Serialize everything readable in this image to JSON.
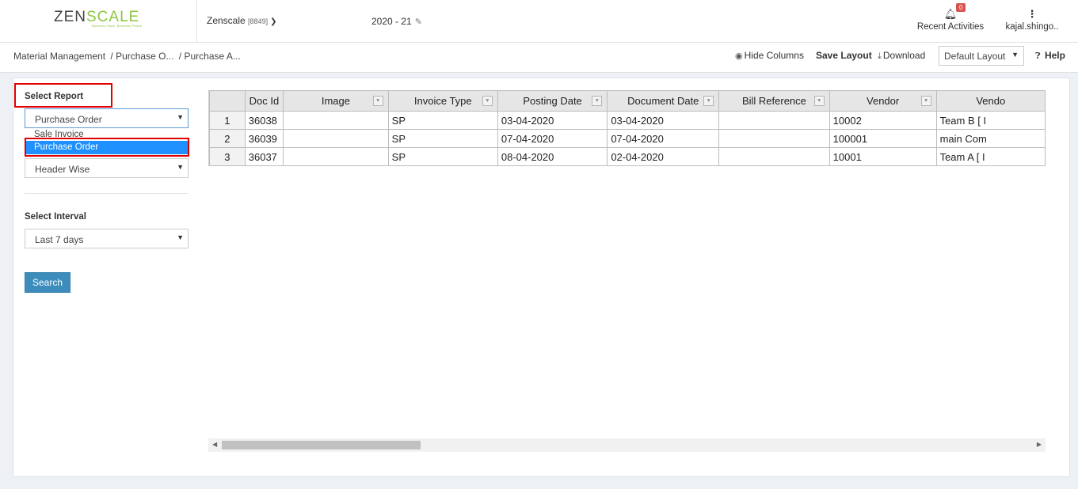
{
  "header": {
    "logo_main": "ZEN",
    "logo_accent": "SCALE",
    "logo_tagline": "Business Ease. Business Peace.",
    "company_name": "Zenscale",
    "company_code": "[8849]",
    "fiscal_year": "2020 - 21",
    "notification_count": "0",
    "recent_activities_label": "Recent Activities",
    "user_name": "kajal.shingo.."
  },
  "breadcrumb": [
    "Material Management",
    "/ Purchase O...",
    "/ Purchase A..."
  ],
  "toolbar": {
    "hide_columns": "Hide Columns",
    "save_layout": "Save Layout",
    "download": "Download",
    "layout_value": "Default Layout",
    "help": "Help"
  },
  "sidebar": {
    "select_report_label": "Select Report",
    "report_value": "Purchase Order",
    "report_options": [
      "Sale Invoice",
      "Purchase Order"
    ],
    "wise_value": "Header Wise",
    "select_interval_label": "Select Interval",
    "interval_value": "Last 7 days",
    "search_button": "Search"
  },
  "grid": {
    "columns": [
      "Doc Id",
      "Image",
      "Invoice Type",
      "Posting Date",
      "Document Date",
      "Bill Reference",
      "Vendor",
      "Vendo"
    ],
    "rows": [
      {
        "n": "1",
        "doc_id": "36038",
        "image": "",
        "invoice_type": "SP",
        "posting_date": "03-04-2020",
        "document_date": "03-04-2020",
        "bill_reference": "",
        "vendor": "10002",
        "vendor_name": "Team B [ I"
      },
      {
        "n": "2",
        "doc_id": "36039",
        "image": "",
        "invoice_type": "SP",
        "posting_date": "07-04-2020",
        "document_date": "07-04-2020",
        "bill_reference": "",
        "vendor": "100001",
        "vendor_name": "main Com"
      },
      {
        "n": "3",
        "doc_id": "36037",
        "image": "",
        "invoice_type": "SP",
        "posting_date": "08-04-2020",
        "document_date": "02-04-2020",
        "bill_reference": "",
        "vendor": "10001",
        "vendor_name": "Team A [ I"
      }
    ]
  },
  "colors": {
    "highlight_red": "#e00000",
    "selected_blue": "#1e90ff",
    "button_blue": "#3c8dbc",
    "logo_green": "#8cc63f"
  }
}
